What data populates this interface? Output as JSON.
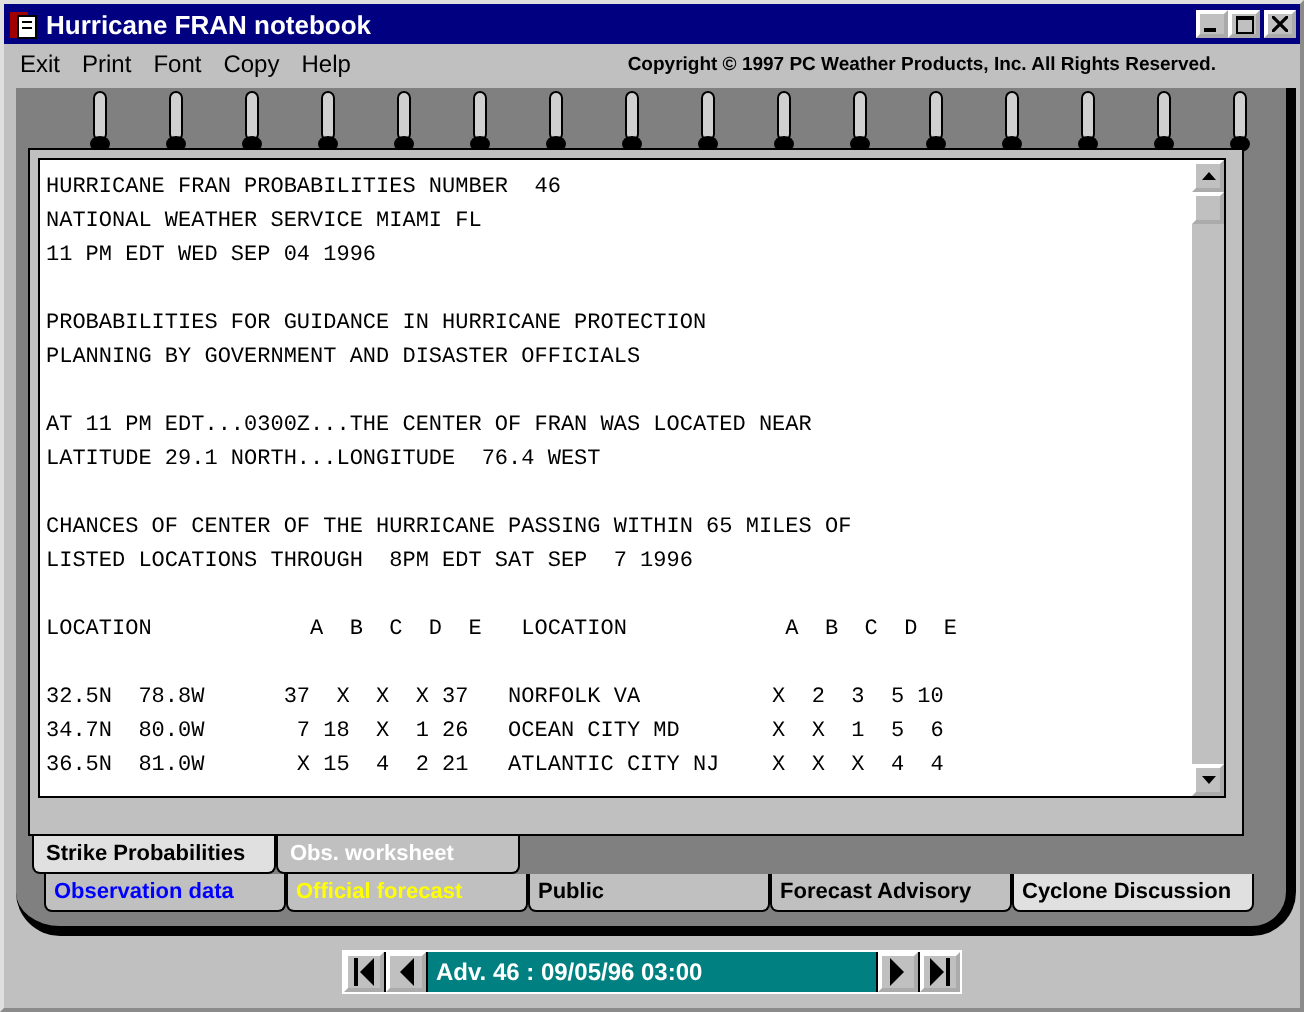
{
  "window": {
    "title": "Hurricane FRAN notebook"
  },
  "menu": [
    "Exit",
    "Print",
    "Font",
    "Copy",
    "Help"
  ],
  "copyright": "Copyright © 1997 PC Weather Products, Inc. All Rights Reserved.",
  "report_paragraphs": [
    [
      "HURRICANE FRAN PROBABILITIES NUMBER  46",
      "NATIONAL WEATHER SERVICE MIAMI FL",
      "11 PM EDT WED SEP 04 1996"
    ],
    [
      "PROBABILITIES FOR GUIDANCE IN HURRICANE PROTECTION",
      "PLANNING BY GOVERNMENT AND DISASTER OFFICIALS"
    ],
    [
      "AT 11 PM EDT...0300Z...THE CENTER OF FRAN WAS LOCATED NEAR",
      "LATITUDE 29.1 NORTH...LONGITUDE  76.4 WEST"
    ],
    [
      "CHANCES OF CENTER OF THE HURRICANE PASSING WITHIN 65 MILES OF",
      "LISTED LOCATIONS THROUGH  8PM EDT SAT SEP  7 1996"
    ],
    [
      "LOCATION            A  B  C  D  E   LOCATION            A  B  C  D  E"
    ],
    [
      "32.5N  78.8W      37  X  X  X 37   NORFOLK VA          X  2  3  5 10",
      "34.7N  80.0W       7 18  X  1 26   OCEAN CITY MD       X  X  1  5  6",
      "36.5N  81.0W       X 15  4  2 21   ATLANTIC CITY NJ    X  X  X  4  4"
    ]
  ],
  "front_tabs": [
    {
      "label": "Strike Probabilities",
      "selected": true,
      "color": "#000000"
    },
    {
      "label": "Obs. worksheet",
      "selected": false,
      "color": "#ffffff"
    }
  ],
  "back_tabs": [
    {
      "label": "Observation data",
      "selected": false,
      "color": "#0000ff"
    },
    {
      "label": "Official forecast",
      "selected": false,
      "color": "#ffff00"
    },
    {
      "label": "Public",
      "selected": false,
      "color": "#000000"
    },
    {
      "label": "Forecast Advisory",
      "selected": false,
      "color": "#000000"
    },
    {
      "label": "Cyclone Discussion",
      "selected": true,
      "color": "#000000"
    }
  ],
  "navigator": {
    "value": "Adv. 46 : 09/05/96 03:00"
  }
}
